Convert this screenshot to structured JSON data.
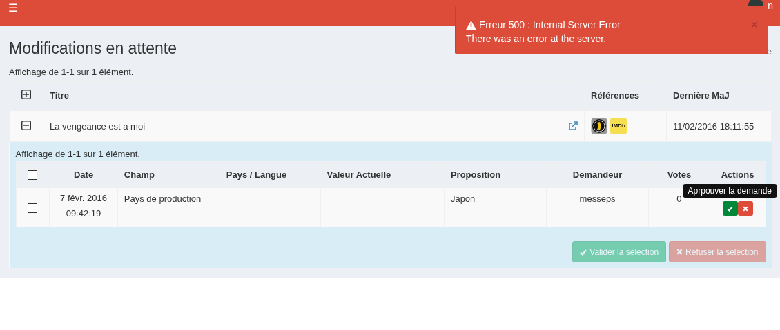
{
  "header": {
    "menu_icon": "☰",
    "user_name": "n"
  },
  "page": {
    "title": "Modifications en attente",
    "breadcrumb": "e",
    "summary": "Affichage de **1-1** sur **1** élément."
  },
  "table": {
    "expand_all": {
      "expanded": false
    },
    "columns": [
      "Titre",
      "Références",
      "Dernière MaJ"
    ],
    "rows": [
      {
        "expanded": true,
        "title": "La vengeance est a moi",
        "references": [
          {
            "kind": "film-reel"
          },
          {
            "kind": "imdb",
            "label": "IMDb"
          }
        ],
        "updated": "11/02/2016 18:11:55",
        "detail": {
          "summary": "Affichage de **1-1** sur **1** élément.",
          "select_all": {
            "checked": false
          },
          "columns": [
            "Date",
            "Champ",
            "Pays / Langue",
            "Valeur Actuelle",
            "Proposition",
            "Demandeur",
            "Votes",
            "Actions"
          ],
          "rows": [
            {
              "checked": false,
              "date": "7 févr. 2016",
              "time": "09:42:19",
              "field": "Pays de production",
              "proposal": "Japon",
              "requester": "messeps",
              "votes": "0",
              "actions": [
                {
                  "kind": "approve",
                  "tooltip": "Aprpouver la demande"
                },
                {
                  "kind": "reject"
                }
              ]
            }
          ],
          "buttons": [
            {
              "kind": "approve",
              "label": "Valider la sélection",
              "disabled": true
            },
            {
              "kind": "reject",
              "label": "Refuser la sélection",
              "disabled": true
            }
          ]
        }
      }
    ]
  },
  "alert": {
    "title": "Erreur 500 : Internal Server Error",
    "message": "There was an error at the server.",
    "close": "×"
  }
}
